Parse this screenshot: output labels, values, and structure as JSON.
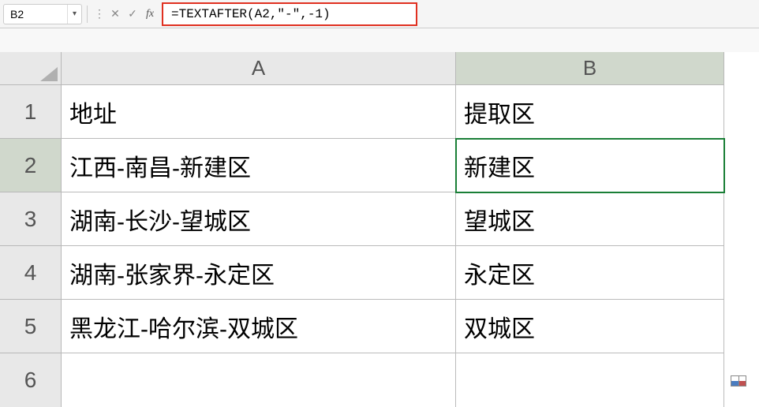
{
  "formula_bar": {
    "name_box_value": "B2",
    "cancel_label": "✕",
    "confirm_label": "✓",
    "fx_label": "fx",
    "formula_value": "=TEXTAFTER(A2,\"-\",-1)"
  },
  "columns": [
    "A",
    "B"
  ],
  "row_headers": [
    "1",
    "2",
    "3",
    "4",
    "5",
    "6"
  ],
  "cells": {
    "A1": "地址",
    "B1": "提取区",
    "A2": "江西-南昌-新建区",
    "B2": "新建区",
    "A3": "湖南-长沙-望城区",
    "B3": "望城区",
    "A4": "湖南-张家界-永定区",
    "B4": "永定区",
    "A5": "黑龙江-哈尔滨-双城区",
    "B5": "双城区",
    "A6": "",
    "B6": ""
  },
  "active_cell": "B2",
  "selected_column": "B",
  "selected_row": "2"
}
